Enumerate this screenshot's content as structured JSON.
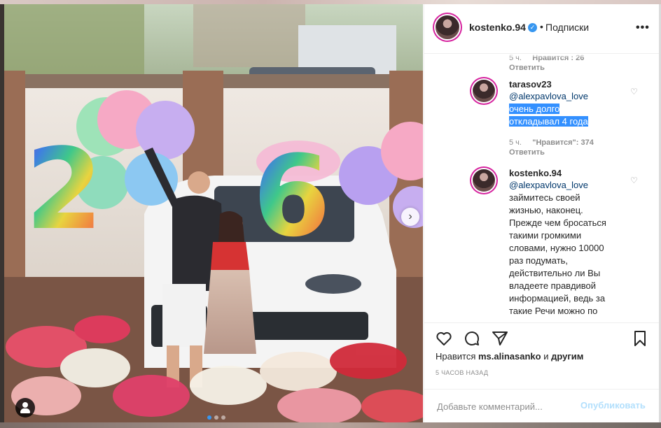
{
  "post": {
    "author": "kostenko.94",
    "separator": "•",
    "follow_label": "Подписки",
    "more_label": "•••"
  },
  "comments": [
    {
      "meta_time": "5 ч.",
      "meta_likes": "Нравится : 26",
      "reply": "Ответить"
    },
    {
      "user": "tarasov23",
      "mention": "@alexpavlova_love",
      "text_line1": "очень долго",
      "text_line2": "откладывал 4 года",
      "meta_time": "5 ч.",
      "meta_likes": "\"Нравится\": 374",
      "reply": "Ответить"
    },
    {
      "user": "kostenko.94",
      "mention": "@alexpavlova_love",
      "lines": [
        "займитесь своей",
        "жизнью, наконец.",
        "Прежде чем бросаться",
        "такими громкими",
        "словами, нужно 10000",
        "раз подумать,",
        "действительно ли Вы",
        "владеете правдивой",
        "информацией, ведь за",
        "такие Речи можно по"
      ]
    }
  ],
  "likes": {
    "prefix": "Нравится",
    "user": "ms.alinasanko",
    "conj": "и",
    "others": "другим"
  },
  "timestamp": "5 часов назад",
  "composer": {
    "placeholder": "Добавьте комментарий...",
    "publish_label": "Опубликовать"
  },
  "photo": {
    "next_glyph": "›"
  },
  "colors": {
    "link": "#00376b",
    "accent": "#3897f0",
    "publish_disabled": "#b2dffc",
    "selection": "#3390ff"
  }
}
